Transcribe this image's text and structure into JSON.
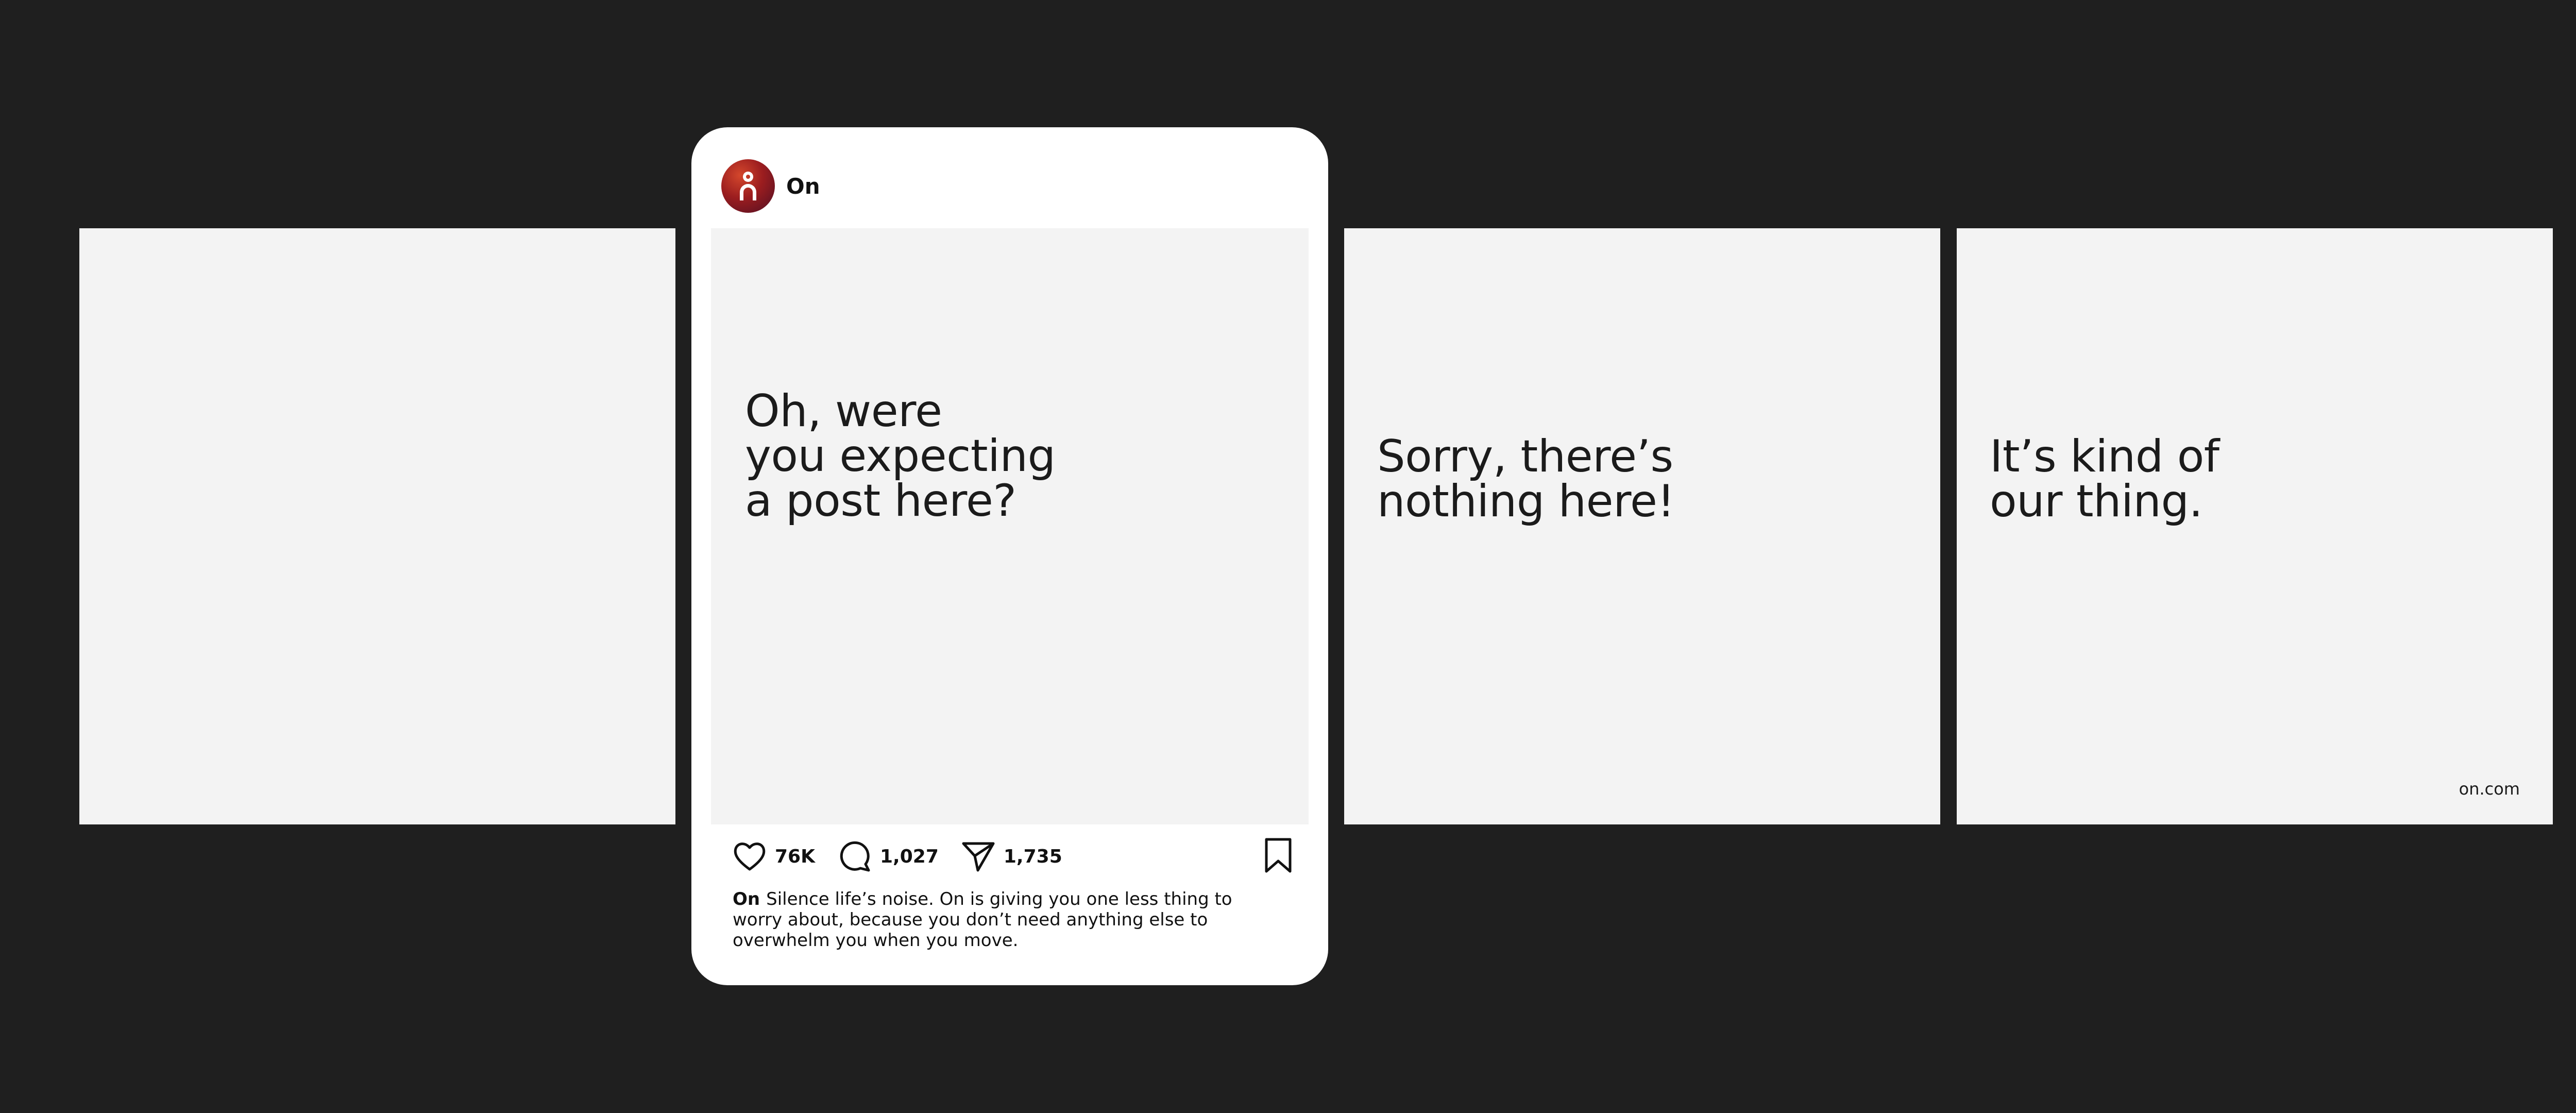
{
  "panels": [
    {
      "headline": ""
    },
    {
      "headline": "Sorry, there’s\nnothing here!"
    },
    {
      "headline": "It’s kind of\nour thing.",
      "domain": "on.com"
    }
  ],
  "post": {
    "account_name": "On",
    "image_headline": "Oh, were\nyou expecting\na post here?",
    "likes": "76K",
    "comments": "1,027",
    "shares": "1,735",
    "caption_author": "On",
    "caption_text": "Silence life’s noise. On is giving you one less thing to worry about, because you don’t need anything else to overwhelm you when you move."
  },
  "icons": {
    "like": "heart-icon",
    "comment": "comment-bubble-icon",
    "share": "paper-plane-icon",
    "save": "bookmark-icon"
  },
  "colors": {
    "background": "#1f1f1f",
    "panel": "#f3f3f3",
    "card": "#ffffff",
    "avatar_primary": "#9b1d1f",
    "text": "#1b1b1b"
  }
}
